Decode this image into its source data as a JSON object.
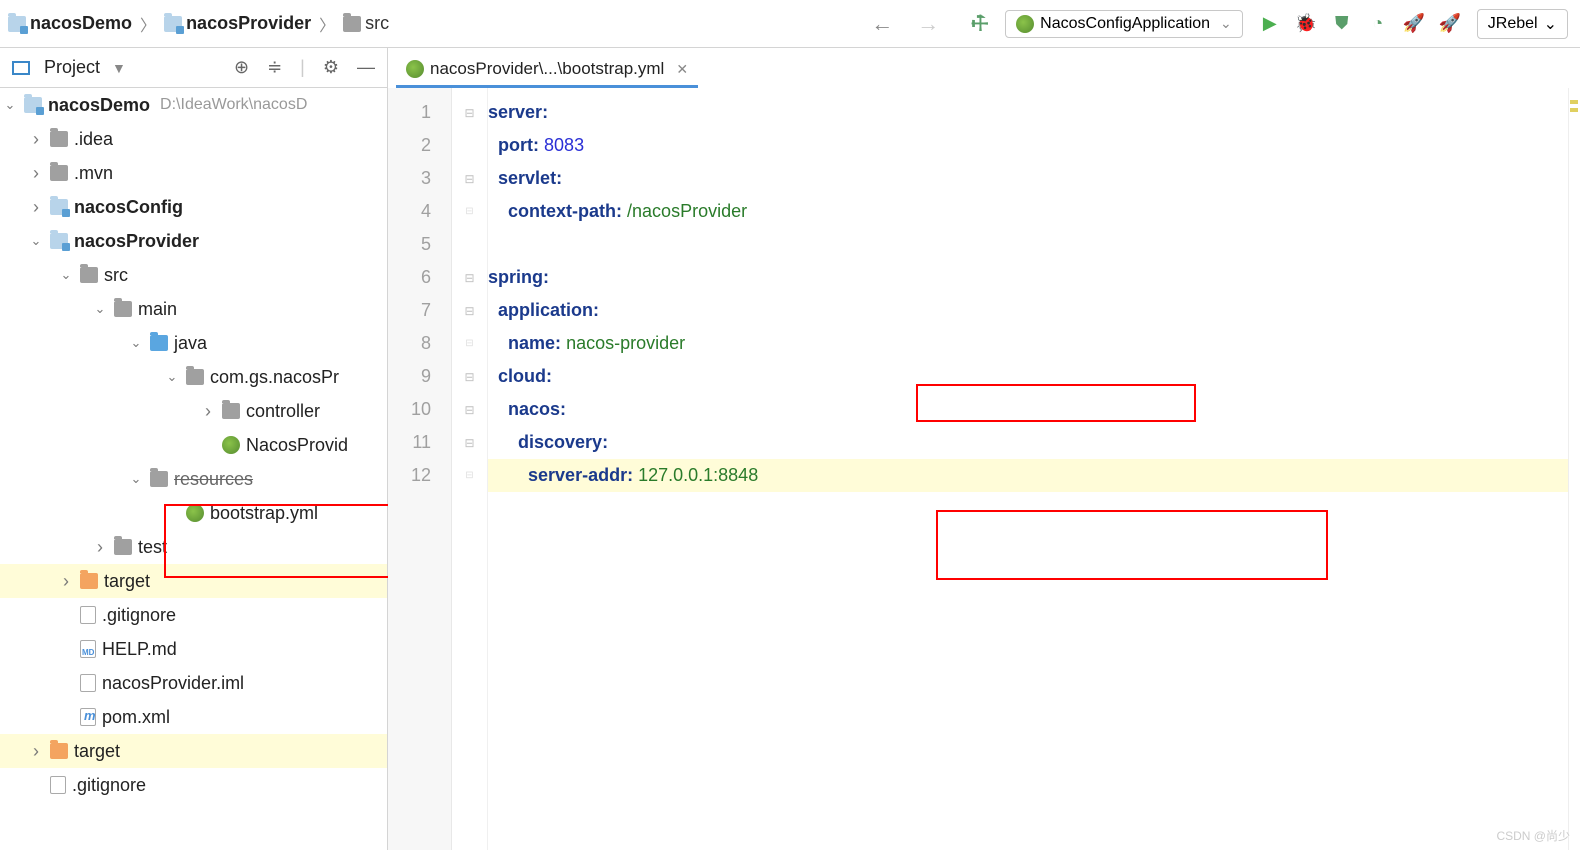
{
  "breadcrumbs": {
    "items": [
      "nacosDemo",
      "nacosProvider",
      "src"
    ]
  },
  "runConfig": {
    "label": "NacosConfigApplication"
  },
  "jrebel": {
    "label": "JRebel"
  },
  "toolWindow": {
    "title": "Project"
  },
  "tree": {
    "rootName": "nacosDemo",
    "rootPath": "D:\\IdeaWork\\nacosD",
    "idea": ".idea",
    "mvn": ".mvn",
    "nacosConfig": "nacosConfig",
    "nacosProvider": "nacosProvider",
    "src": "src",
    "main": "main",
    "java": "java",
    "pkg": "com.gs.nacosPr",
    "controller": "controller",
    "appClass": "NacosProvid",
    "resources": "resources",
    "bootstrap": "bootstrap.yml",
    "test": "test",
    "target": "target",
    "gitignore": ".gitignore",
    "help": "HELP.md",
    "iml": "nacosProvider.iml",
    "pom": "pom.xml",
    "target2": "target",
    "gitignore2": ".gitignore"
  },
  "tab": {
    "label": "nacosProvider\\...\\bootstrap.yml"
  },
  "code": {
    "l1_key": "server",
    "colon": ":",
    "l2_key": "port",
    "l2_val": "8083",
    "l3_key": "servlet",
    "l4_key": "context-path",
    "l4_val": "/nacosProvider",
    "l6_key": "spring",
    "l7_key": "application",
    "l8_key": "name",
    "l8_val": "nacos-provider",
    "l9_key": "cloud",
    "l10_key": "nacos",
    "l11_key": "discovery",
    "l12_key": "server-addr",
    "l12_val": "127.0.0.1:8848"
  },
  "watermark": "CSDN @尚少"
}
